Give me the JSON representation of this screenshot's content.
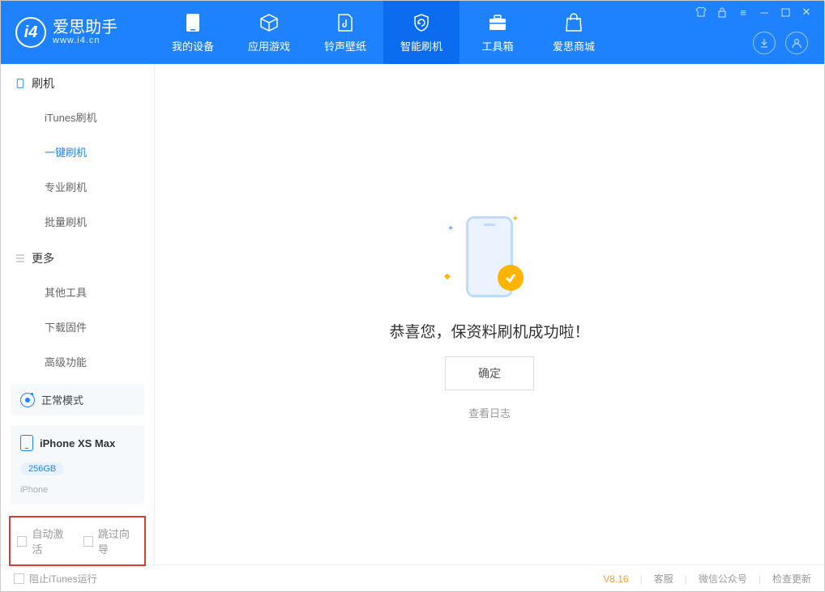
{
  "app": {
    "title": "爱思助手",
    "subtitle": "www.i4.cn"
  },
  "tabs": {
    "device": "我的设备",
    "apps": "应用游戏",
    "ringtone": "铃声壁纸",
    "flash": "智能刷机",
    "toolbox": "工具箱",
    "store": "爱思商城"
  },
  "sidebar": {
    "group1": "刷机",
    "items1": {
      "itunes": "iTunes刷机",
      "oneclick": "一键刷机",
      "pro": "专业刷机",
      "batch": "批量刷机"
    },
    "group2": "更多",
    "items2": {
      "other": "其他工具",
      "firmware": "下载固件",
      "advanced": "高级功能"
    }
  },
  "device": {
    "mode": "正常模式",
    "name": "iPhone XS Max",
    "storage": "256GB",
    "type": "iPhone"
  },
  "options": {
    "auto_activate": "自动激活",
    "skip_guide": "跳过向导"
  },
  "main": {
    "success": "恭喜您，保资料刷机成功啦！",
    "ok": "确定",
    "view_log": "查看日志"
  },
  "footer": {
    "block_itunes": "阻止iTunes运行",
    "version": "V8.16",
    "support": "客服",
    "wechat": "微信公众号",
    "update": "检查更新"
  }
}
